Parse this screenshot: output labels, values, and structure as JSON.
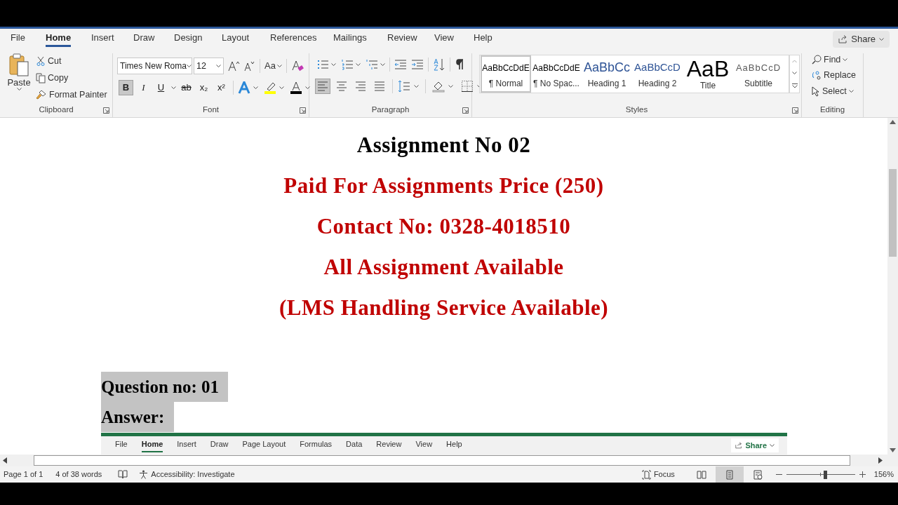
{
  "tabs": [
    {
      "label": "File",
      "selected": false
    },
    {
      "label": "Home",
      "selected": true
    },
    {
      "label": "Insert",
      "selected": false
    },
    {
      "label": "Draw",
      "selected": false
    },
    {
      "label": "Design",
      "selected": false
    },
    {
      "label": "Layout",
      "selected": false
    },
    {
      "label": "References",
      "selected": false
    },
    {
      "label": "Mailings",
      "selected": false
    },
    {
      "label": "Review",
      "selected": false
    },
    {
      "label": "View",
      "selected": false
    },
    {
      "label": "Help",
      "selected": false
    }
  ],
  "share": "Share",
  "clipboard": {
    "paste": "Paste",
    "cut": "Cut",
    "copy": "Copy",
    "format_painter": "Format Painter",
    "label": "Clipboard"
  },
  "font": {
    "name": "Times New Roma",
    "size": "12",
    "case_button": "Aa",
    "label": "Font",
    "format_buttons": [
      {
        "label": "B",
        "selected": true
      },
      {
        "label": "I",
        "selected": false
      },
      {
        "label": "U",
        "selected": false
      },
      {
        "label": "ab",
        "selected": false
      },
      {
        "label": "x₂",
        "selected": false
      },
      {
        "label": "x²",
        "selected": false
      }
    ]
  },
  "paragraph": {
    "label": "Paragraph",
    "alignments": [
      {
        "kind": "left",
        "selected": true
      },
      {
        "kind": "center",
        "selected": false
      },
      {
        "kind": "right",
        "selected": false
      },
      {
        "kind": "justify",
        "selected": false
      }
    ]
  },
  "styles": {
    "label": "Styles",
    "items": [
      {
        "preview": "AaBbCcDdE",
        "name": "¶ Normal",
        "kind": "normal",
        "selected": true
      },
      {
        "preview": "AaBbCcDdE",
        "name": "¶ No Spac...",
        "kind": "normal",
        "selected": false
      },
      {
        "preview": "AaBbCc",
        "name": "Heading 1",
        "kind": "heading1",
        "selected": false
      },
      {
        "preview": "AaBbCcD",
        "name": "Heading 2",
        "kind": "heading2",
        "selected": false
      },
      {
        "preview": "AaB",
        "name": "Title",
        "kind": "title",
        "selected": false
      },
      {
        "preview": "AaBbCcD",
        "name": "Subtitle",
        "kind": "subtitle",
        "selected": false
      }
    ]
  },
  "editing": {
    "label": "Editing",
    "find": "Find",
    "replace": "Replace",
    "select": "Select"
  },
  "document": {
    "lines": [
      {
        "text": "Assignment No 02",
        "color": "#000000"
      },
      {
        "text": "Paid For Assignments Price (250)",
        "color": "#c00000"
      },
      {
        "text": "Contact No: 0328-4018510",
        "color": "#c00000"
      },
      {
        "text": "All Assignment Available",
        "color": "#c00000"
      },
      {
        "text": "(LMS Handling Service Available)",
        "color": "#c00000"
      }
    ],
    "question": {
      "text": "Question no: 01",
      "selected": true
    },
    "answer": {
      "text": "Answer:",
      "selected": true
    },
    "pasted_ribbon": {
      "tabs": [
        {
          "label": "File",
          "selected": false
        },
        {
          "label": "Home",
          "selected": true
        },
        {
          "label": "Insert",
          "selected": false
        },
        {
          "label": "Draw",
          "selected": false
        },
        {
          "label": "Page Layout",
          "selected": false
        },
        {
          "label": "Formulas",
          "selected": false
        },
        {
          "label": "Data",
          "selected": false
        },
        {
          "label": "Review",
          "selected": false
        },
        {
          "label": "View",
          "selected": false
        },
        {
          "label": "Help",
          "selected": false
        }
      ],
      "share": "Share"
    }
  },
  "status_bar": {
    "page": "Page 1 of 1",
    "words": "4 of 38 words",
    "accessibility": "Accessibility: Investigate",
    "focus": "Focus",
    "zoom": {
      "level": 0.56,
      "reading": "156%"
    },
    "views": [
      {
        "kind": "read",
        "selected": false
      },
      {
        "kind": "print",
        "selected": true
      },
      {
        "kind": "web",
        "selected": false
      }
    ]
  }
}
